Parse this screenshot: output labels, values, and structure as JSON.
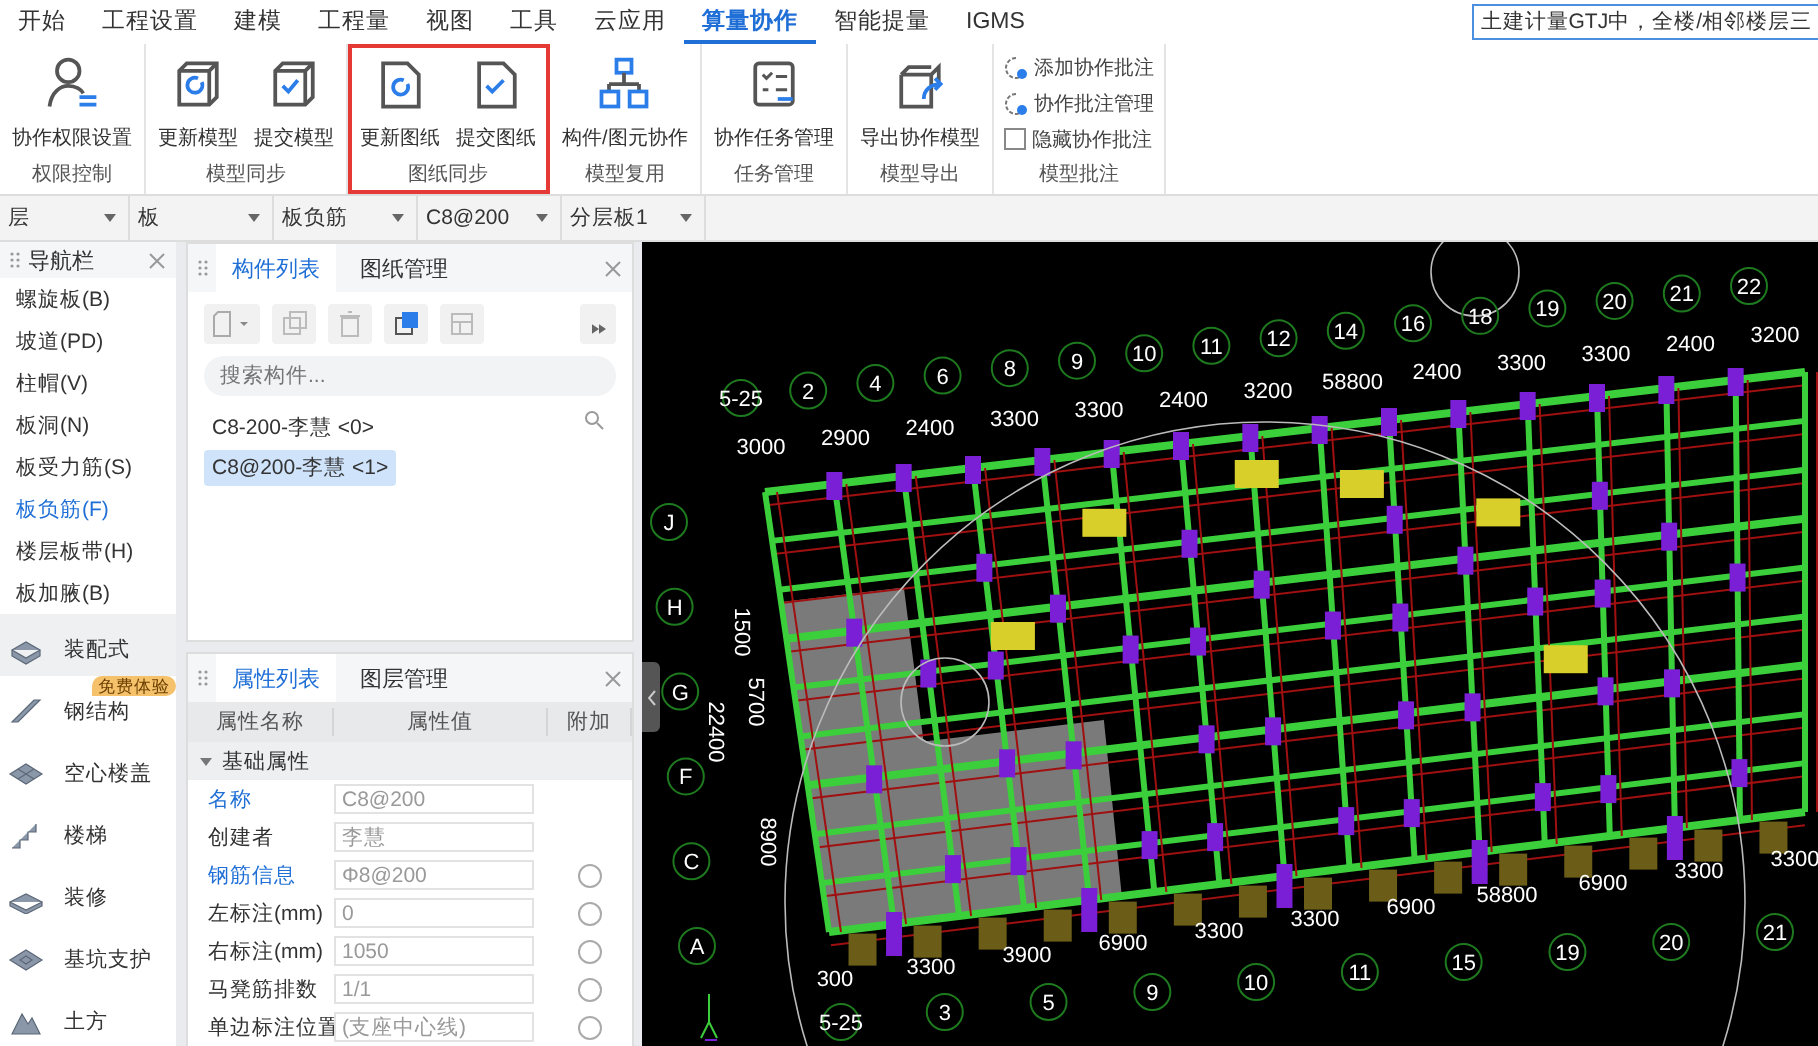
{
  "menu_tabs": [
    {
      "label": "开始",
      "selected": false
    },
    {
      "label": "工程设置",
      "selected": false
    },
    {
      "label": "建模",
      "selected": false
    },
    {
      "label": "工程量",
      "selected": false
    },
    {
      "label": "视图",
      "selected": false
    },
    {
      "label": "工具",
      "selected": false
    },
    {
      "label": "云应用",
      "selected": false
    },
    {
      "label": "算量协作",
      "selected": true
    },
    {
      "label": "智能提量",
      "selected": false
    },
    {
      "label": "IGMS",
      "selected": false
    }
  ],
  "search": {
    "value": "土建计量GTJ中，全楼/相邻楼层三"
  },
  "ribbon": [
    {
      "label": "权限控制",
      "highlighted": false,
      "items": [
        {
          "kind": "large",
          "label": "协作权限设置"
        }
      ]
    },
    {
      "label": "模型同步",
      "highlighted": false,
      "items": [
        {
          "kind": "large",
          "label": "更新模型"
        },
        {
          "kind": "large",
          "label": "提交模型"
        }
      ]
    },
    {
      "label": "图纸同步",
      "highlighted": true,
      "items": [
        {
          "kind": "large",
          "label": "更新图纸"
        },
        {
          "kind": "large",
          "label": "提交图纸"
        }
      ]
    },
    {
      "label": "模型复用",
      "highlighted": false,
      "items": [
        {
          "kind": "large",
          "label": "构件/图元协作"
        }
      ]
    },
    {
      "label": "任务管理",
      "highlighted": false,
      "items": [
        {
          "kind": "large",
          "label": "协作任务管理"
        }
      ]
    },
    {
      "label": "模型导出",
      "highlighted": false,
      "items": [
        {
          "kind": "large",
          "label": "导出协作模型"
        }
      ]
    },
    {
      "label": "模型批注",
      "highlighted": false,
      "items": [
        {
          "kind": "small",
          "label": "添加协作批注"
        },
        {
          "kind": "small",
          "label": "协作批注管理"
        },
        {
          "kind": "checkbox",
          "label": "隐藏协作批注",
          "checked": false
        }
      ]
    }
  ],
  "selectors": [
    "层",
    "板",
    "板负筋",
    "C8@200",
    "分层板1"
  ],
  "navigator": {
    "title": "导航栏",
    "items": [
      {
        "label": "螺旋板(B)",
        "selected": false
      },
      {
        "label": "坡道(PD)",
        "selected": false
      },
      {
        "label": "柱帽(V)",
        "selected": false
      },
      {
        "label": "板洞(N)",
        "selected": false
      },
      {
        "label": "板受力筋(S)",
        "selected": false
      },
      {
        "label": "板负筋(F)",
        "selected": true
      },
      {
        "label": "楼层板带(H)",
        "selected": false
      },
      {
        "label": "板加腋(B)",
        "selected": false
      }
    ],
    "categories": [
      {
        "label": "装配式",
        "selected": true
      },
      {
        "label": "钢结构",
        "selected": false,
        "badge": "免费体验"
      },
      {
        "label": "空心楼盖",
        "selected": false
      },
      {
        "label": "楼梯",
        "selected": false
      },
      {
        "label": "装修",
        "selected": false
      },
      {
        "label": "基坑支护",
        "selected": false
      },
      {
        "label": "土方",
        "selected": false
      }
    ]
  },
  "component_panel": {
    "tabs": [
      {
        "label": "构件列表",
        "selected": true
      },
      {
        "label": "图纸管理",
        "selected": false
      }
    ],
    "search": {
      "placeholder": "搜索构件..."
    },
    "items": [
      {
        "label": "C8-200-李慧 <0>",
        "selected": false
      },
      {
        "label": "C8@200-李慧 <1>",
        "selected": true
      }
    ]
  },
  "property_panel": {
    "tabs": [
      {
        "label": "属性列表",
        "selected": true
      },
      {
        "label": "图层管理",
        "selected": false
      }
    ],
    "columns": [
      "属性名称",
      "属性值",
      "附加"
    ],
    "group": {
      "label": "基础属性",
      "expanded": true
    },
    "rows": [
      {
        "name": "名称",
        "value": "C8@200",
        "highlighted": true,
        "kind": "fixed"
      },
      {
        "name": "创建者",
        "value": "李慧",
        "highlighted": false,
        "kind": "fixed"
      },
      {
        "name": "钢筋信息",
        "value": "Φ8@200",
        "highlighted": true,
        "kind": "attachable",
        "attached": false
      },
      {
        "name": "左标注(mm)",
        "value": "0",
        "highlighted": false,
        "kind": "attachable",
        "attached": false
      },
      {
        "name": "右标注(mm)",
        "value": "1050",
        "highlighted": false,
        "kind": "attachable",
        "attached": false
      },
      {
        "name": "马凳筋排数",
        "value": "1/1",
        "highlighted": false,
        "kind": "attachable",
        "attached": false
      },
      {
        "name": "单边标注位置",
        "value": "(支座中心线)",
        "highlighted": false,
        "kind": "attachable",
        "attached": false
      }
    ]
  },
  "view": {
    "top_axis": [
      "5-25",
      "2",
      "4",
      "6",
      "8",
      "9",
      "10",
      "11",
      "12",
      "14",
      "16",
      "18",
      "19",
      "20",
      "21",
      "22"
    ],
    "top_dims": [
      "3000",
      "2900",
      "2400",
      "3300",
      "3300",
      "2400",
      "3200",
      "58800",
      "2400",
      "3300",
      "3300",
      "2400",
      "3200"
    ],
    "left_axis": [
      "J",
      "H",
      "G",
      "F",
      "C",
      "A"
    ],
    "left_dims": [
      "1500",
      "5700",
      "22400",
      "8900"
    ],
    "bottom_dims": [
      "300",
      "3300",
      "3900",
      "6900",
      "3300",
      "3300",
      "6900",
      "58800",
      "6900",
      "3300",
      "3300"
    ],
    "bottom_axis": [
      "5-25",
      "3",
      "5",
      "9",
      "10",
      "11",
      "15",
      "19",
      "20",
      "21"
    ]
  }
}
